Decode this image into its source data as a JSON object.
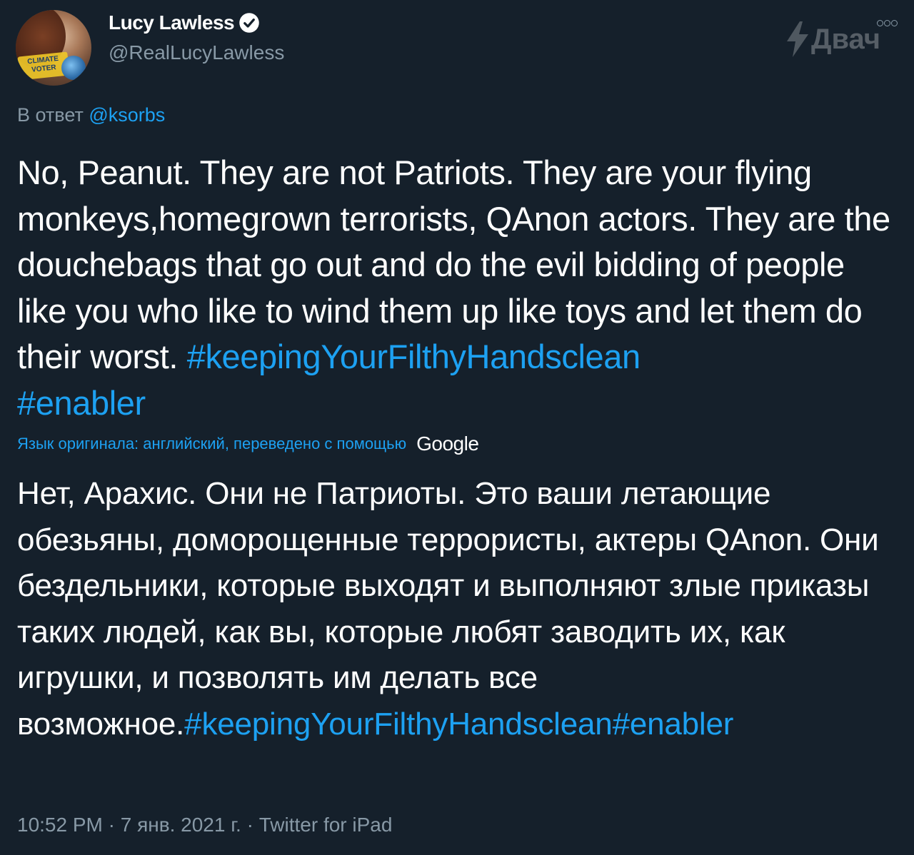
{
  "author": {
    "name": "Lucy Lawless",
    "handle": "@RealLucyLawless",
    "avatar_badge_text": "CLIMATE VOTER"
  },
  "watermark": "Двач",
  "reply": {
    "prefix": "В ответ",
    "mention": "@ksorbs"
  },
  "tweet": {
    "text": "No, Peanut. They are not Patriots. They are your flying monkeys,homegrown terrorists, QAnon actors. They are the douchebags that go out and do the evil bidding of people like you who like to wind them up like toys and let them do their worst. ",
    "hashtag1": "#keepingYourFilthyHandsclean",
    "hashtag2": "#enabler"
  },
  "translation": {
    "note": "Язык оригинала: английский, переведено с помощью",
    "provider": "Google",
    "text": "Нет, Арахис. Они не Патриоты. Это ваши летающие обезьяны, доморощенные террористы, актеры QAnon. Они бездельники, которые выходят и выполняют злые приказы таких людей, как вы, которые любят заводить их, как игрушки, и позволять им делать все возможное.",
    "hashtag1": "#keepingYourFilthyHandsclean",
    "hashtag2": "#enabler"
  },
  "meta": {
    "time": "10:52 PM",
    "sep1": " · ",
    "date": "7 янв. 2021 г.",
    "sep2": " · ",
    "source": "Twitter for iPad"
  },
  "colors": {
    "background": "#15202b",
    "accent": "#1da1f2",
    "secondary_text": "#8899a6"
  },
  "icons": [
    "verified-badge-icon",
    "more-options-icon",
    "lightning-icon"
  ]
}
